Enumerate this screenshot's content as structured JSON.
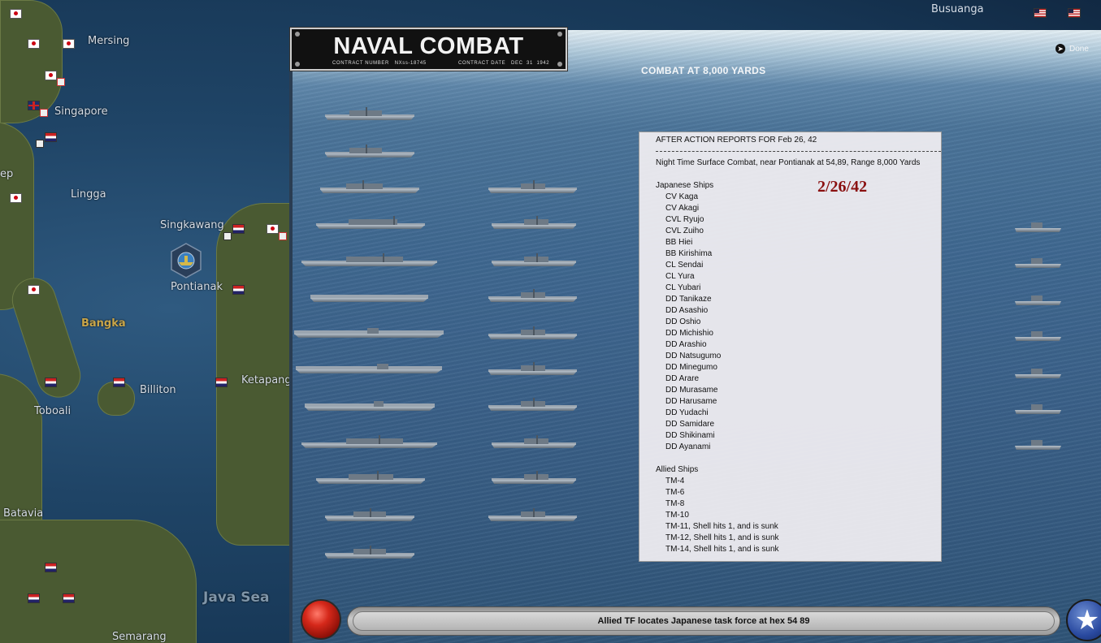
{
  "map": {
    "labels": {
      "mersing": "Mersing",
      "singapore": "Singapore",
      "lingga": "Lingga",
      "singkawang": "Singkawang",
      "pontianak": "Pontianak",
      "bangka": "Bangka",
      "billiton": "Billiton",
      "ketapang": "Ketapang",
      "toboali": "Toboali",
      "batavia": "Batavia",
      "java_sea": "Java Sea",
      "semarang": "Semarang",
      "busuanga": "Busuanga",
      "edge_left": "ep"
    }
  },
  "panel": {
    "title": "NAVAL COMBAT",
    "contract_number": "CONTRACT NUMBER   NXss-18745",
    "contract_date": "CONTRACT DATE   DEC  31  1942",
    "range_header": "COMBAT AT 8,000 YARDS",
    "done_label": "Done"
  },
  "report": {
    "header": "AFTER ACTION REPORTS FOR Feb 26, 42",
    "summary": "Night Time Surface Combat, near Pontianak at 54,89, Range 8,000 Yards",
    "date_stamp": "2/26/42",
    "japanese_heading": "Japanese Ships",
    "japanese_ships": [
      "CV Kaga",
      "CV Akagi",
      "CVL Ryujo",
      "CVL Zuiho",
      "BB Hiei",
      "BB Kirishima",
      "CL Sendai",
      "CL Yura",
      "CL Yubari",
      "DD Tanikaze",
      "DD Asashio",
      "DD Oshio",
      "DD Michishio",
      "DD Arashio",
      "DD Natsugumo",
      "DD Minegumo",
      "DD Arare",
      "DD Murasame",
      "DD Harusame",
      "DD Yudachi",
      "DD Samidare",
      "DD Shikinami",
      "DD Ayanami"
    ],
    "allied_heading": "Allied Ships",
    "allied_ships": [
      "TM-4",
      "TM-6",
      "TM-8",
      "TM-10",
      "TM-11, Shell hits 1, and is sunk",
      "TM-12, Shell hits 1, and is sunk",
      "TM-14, Shell hits 1, and is sunk"
    ]
  },
  "status": {
    "message": "Allied TF locates Japanese task force at hex 54 89"
  },
  "icons": {
    "red_button": "red-circle-button-icon",
    "star_button": "star-icon",
    "done": "arrow-right-icon"
  }
}
